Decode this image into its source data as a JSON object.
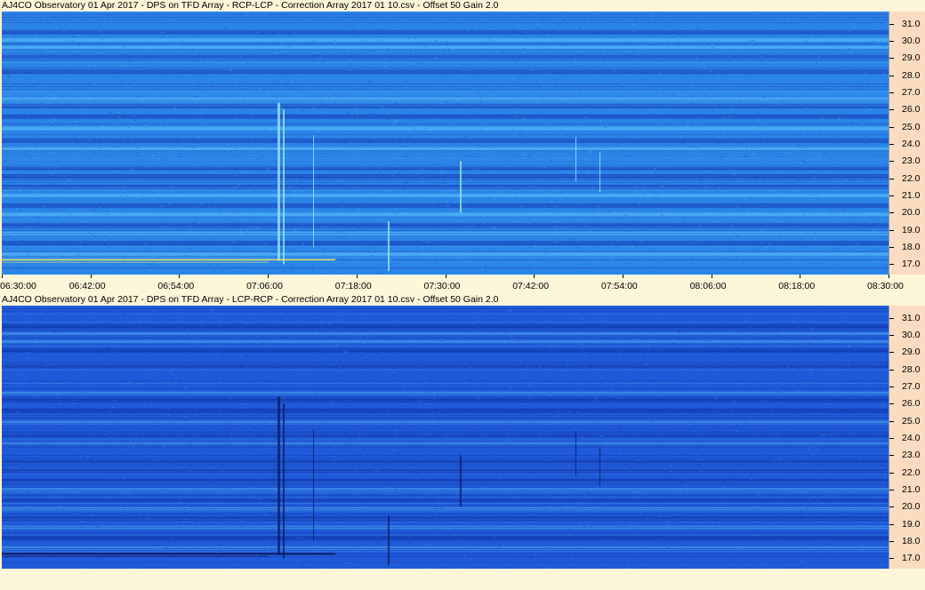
{
  "panels": [
    {
      "title": "AJ4CO Observatory 01 Apr 2017  -  DPS on TFD Array  -  RCP-LCP  -  Correction Array 2017 01 10.csv  -  Offset 50  Gain 2.0",
      "bg": "#2a84e6",
      "stripe_light": "#5fc8ff",
      "stripe_dark": "#1538b8",
      "trace": "#e8e860"
    },
    {
      "title": "AJ4CO Observatory 01 Apr 2017  -  DPS on TFD Array  -  LCP-RCP  -  Correction Array 2017 01 10.csv  -  Offset 50  Gain 2.0",
      "bg": "#1f5ad8",
      "stripe_light": "#4aa8f4",
      "stripe_dark": "#1030a8",
      "trace": "#0a0a40"
    }
  ],
  "chart_data": [
    {
      "type": "heatmap",
      "title": "AJ4CO Observatory 01 Apr 2017  -  DPS on TFD Array  -  RCP-LCP  -  Correction Array 2017 01 10.csv  -  Offset 50  Gain 2.0",
      "x_tick_labels": [
        "06:30:00",
        "06:42:00",
        "06:54:00",
        "07:06:00",
        "07:18:00",
        "07:30:00",
        "07:42:00",
        "07:54:00",
        "08:06:00",
        "08:18:00",
        "08:30:00"
      ],
      "y_tick_labels": [
        "31.0",
        "30.0",
        "29.0",
        "28.0",
        "27.0",
        "26.0",
        "25.0",
        "24.0",
        "23.0",
        "22.0",
        "21.0",
        "20.0",
        "19.0",
        "18.0",
        "17.0"
      ],
      "y_range": [
        16.4,
        31.7
      ],
      "x_range": [
        "06:30:00",
        "08:30:00"
      ]
    },
    {
      "type": "heatmap",
      "title": "AJ4CO Observatory 01 Apr 2017  -  DPS on TFD Array  -  LCP-RCP  -  Correction Array 2017 01 10.csv  -  Offset 50  Gain 2.0",
      "y_tick_labels": [
        "31.0",
        "30.0",
        "29.0",
        "28.0",
        "27.0",
        "26.0",
        "25.0",
        "24.0",
        "23.0",
        "22.0",
        "21.0",
        "20.0",
        "19.0",
        "18.0",
        "17.0"
      ],
      "y_range": [
        16.4,
        31.7
      ],
      "x_range": [
        "06:30:00",
        "08:30:00"
      ]
    }
  ]
}
